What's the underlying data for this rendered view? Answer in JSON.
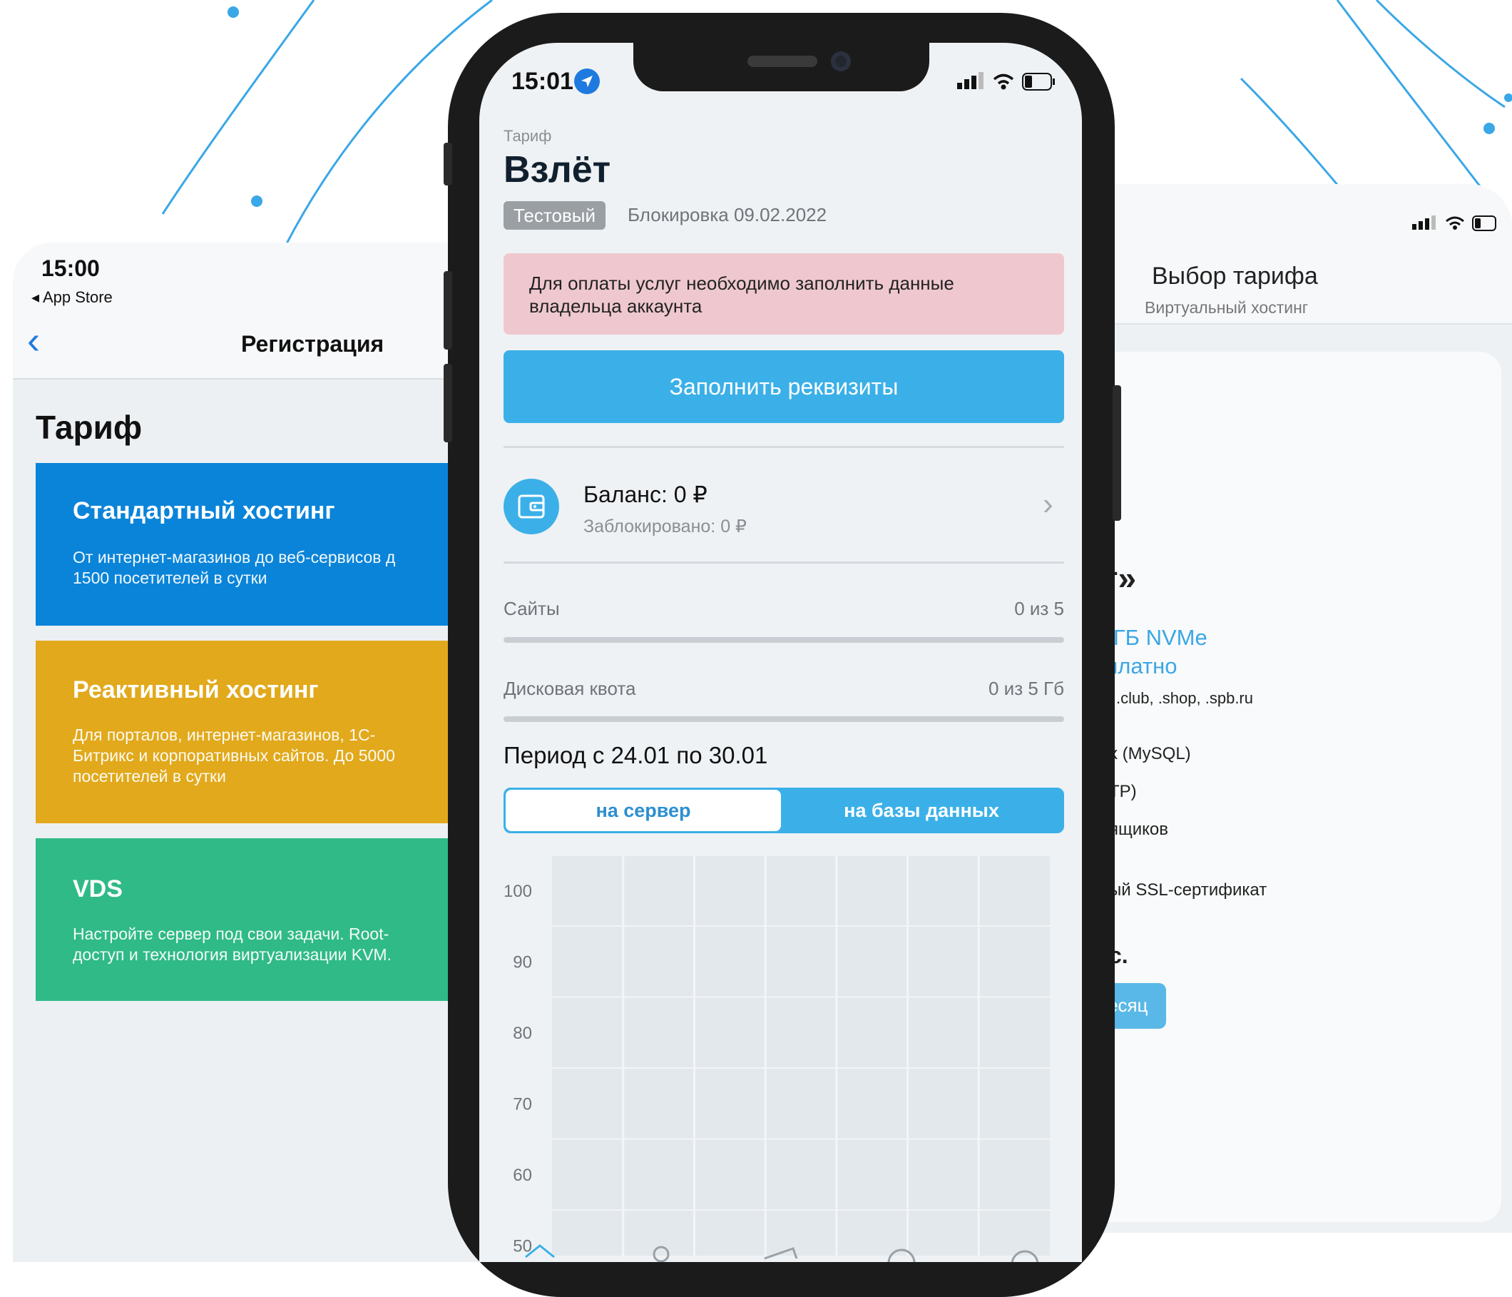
{
  "colors": {
    "accent": "#3bb0e8",
    "ios_blue": "#1f7ae0",
    "alert_bg": "#efc8cf",
    "card_standard": "#0a84d9",
    "card_reactive": "#e1a91b",
    "card_vds": "#2fba87"
  },
  "left": {
    "time": "15:00",
    "back_app": "◂ App Store",
    "nav_title": "Регистрация",
    "heading": "Тариф",
    "plans": [
      {
        "title": "Стандартный хостинг",
        "desc": "От интернет-магазинов до веб-сервисов д\n1500 посетителей в сутки"
      },
      {
        "title": "Реактивный хостинг",
        "desc": "Для порталов, интернет-магазинов, 1С-\nБитрикс и корпоративных сайтов. До 5000\nпосетителей в сутки"
      },
      {
        "title": "VDS",
        "desc": "Настройте сервер под свои задачи. Root-\nдоступ и технология виртуализации KVM."
      }
    ]
  },
  "right": {
    "title": "Выбор тарифа",
    "subtitle": "Виртуальный хостинг",
    "plan_name_tail": "т»",
    "disk": "5 ГБ NVMe",
    "free": "сплатно",
    "domains": ".club, .shop, .spb.ru",
    "feature_1": "х (MySQL)",
    "feature_2": "ТР)",
    "feature_3": "ящиков",
    "feature_4": "ый SSL-сертификат",
    "price_tail": "с.",
    "button_tail": "есяц"
  },
  "main": {
    "time": "15:01",
    "label": "Тариф",
    "title": "Взлёт",
    "badge": "Тестовый",
    "blocked_until": "Блокировка 09.02.2022",
    "alert": "Для оплаты услуг необходимо заполнить данные\nвладельца аккаунта",
    "fill_button": "Заполнить реквизиты",
    "balance": "Баланс: 0 ₽",
    "balance_blocked": "Заблокировано: 0 ₽",
    "sites_label": "Сайты",
    "sites_value": "0 из 5",
    "sites_used_fraction": 0,
    "disk_label": "Дисковая квота",
    "disk_value": "0 из 5 Гб",
    "disk_used_fraction": 0,
    "period": "Период с 24.01 по 30.01",
    "segments": [
      "на сервер",
      "на базы данных"
    ],
    "selected_segment": "на сервер"
  },
  "chart_data": {
    "type": "bar",
    "y_ticks": [
      "100",
      "90",
      "80",
      "70",
      "60",
      "50"
    ],
    "ylim": [
      50,
      100
    ],
    "columns": 7,
    "grid": true,
    "series": []
  }
}
